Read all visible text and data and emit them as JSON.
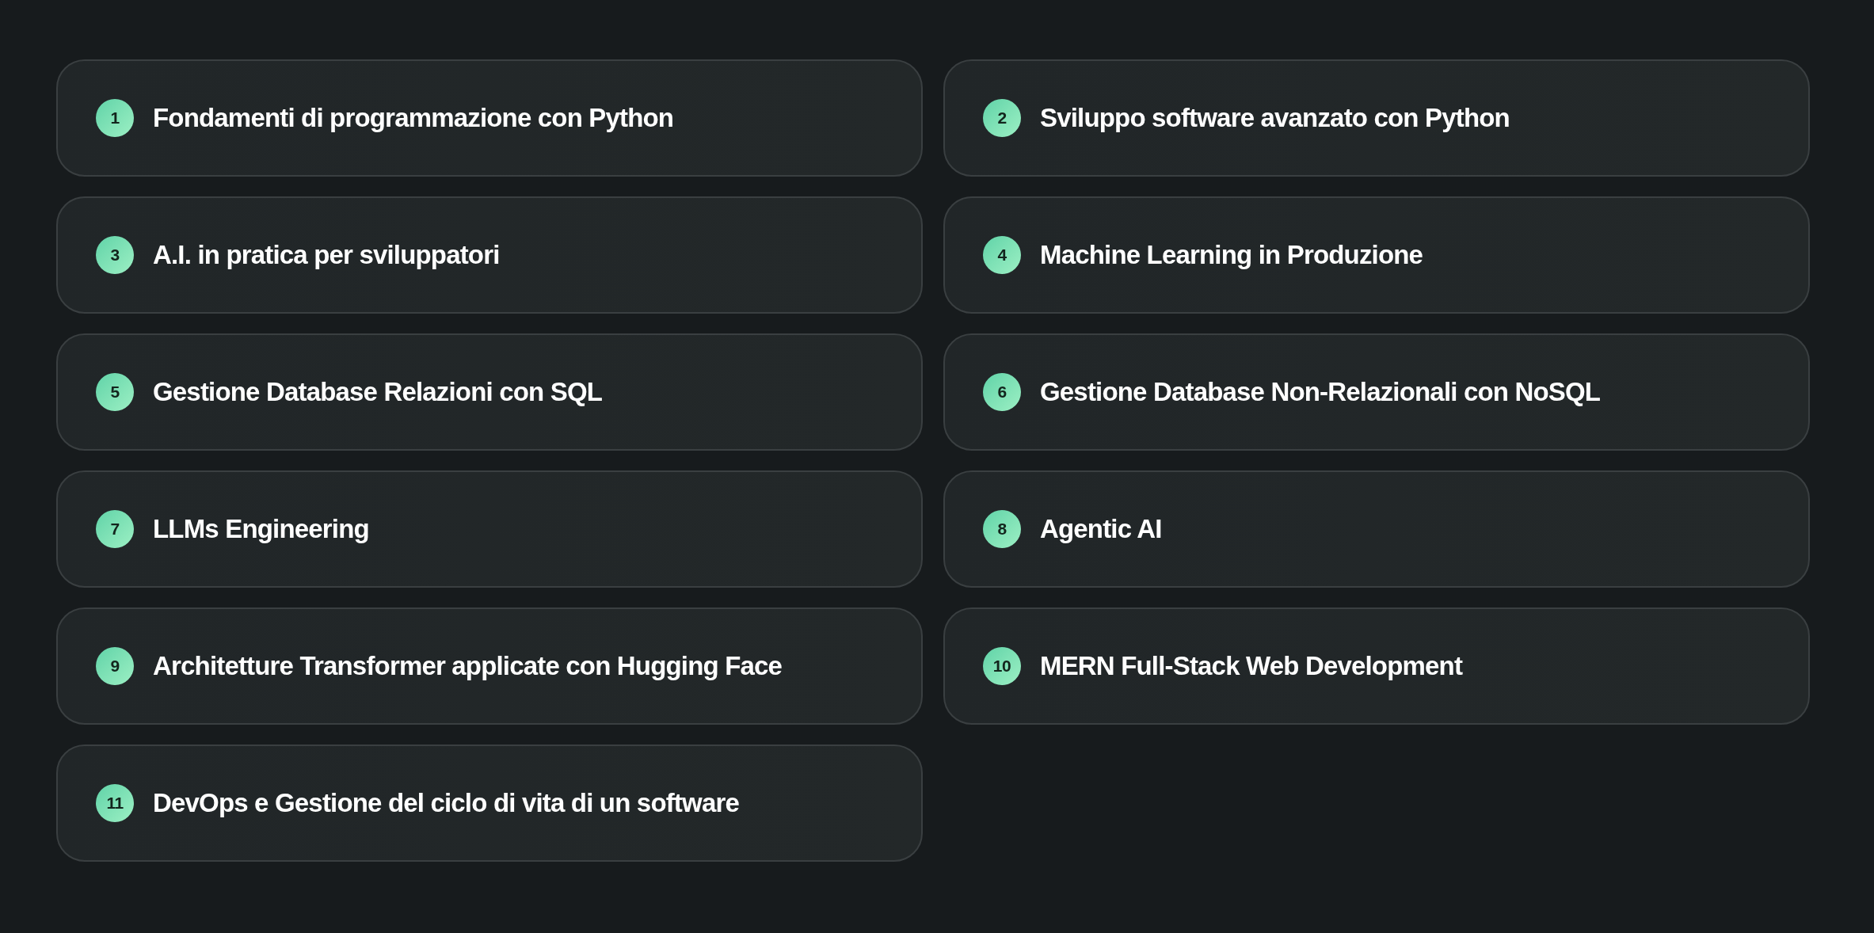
{
  "courses": [
    {
      "number": "1",
      "title": "Fondamenti di programmazione con Python"
    },
    {
      "number": "2",
      "title": "Sviluppo software avanzato con Python"
    },
    {
      "number": "3",
      "title": "A.I. in pratica per sviluppatori"
    },
    {
      "number": "4",
      "title": "Machine Learning in Produzione"
    },
    {
      "number": "5",
      "title": "Gestione Database Relazioni con SQL"
    },
    {
      "number": "6",
      "title": "Gestione Database Non-Relazionali con NoSQL"
    },
    {
      "number": "7",
      "title": "LLMs Engineering"
    },
    {
      "number": "8",
      "title": "Agentic AI"
    },
    {
      "number": "9",
      "title": "Architetture Transformer applicate con Hugging Face"
    },
    {
      "number": "10",
      "title": "MERN Full-Stack Web Development"
    },
    {
      "number": "11",
      "title": "DevOps e Gestione del ciclo di vita di un software"
    }
  ]
}
